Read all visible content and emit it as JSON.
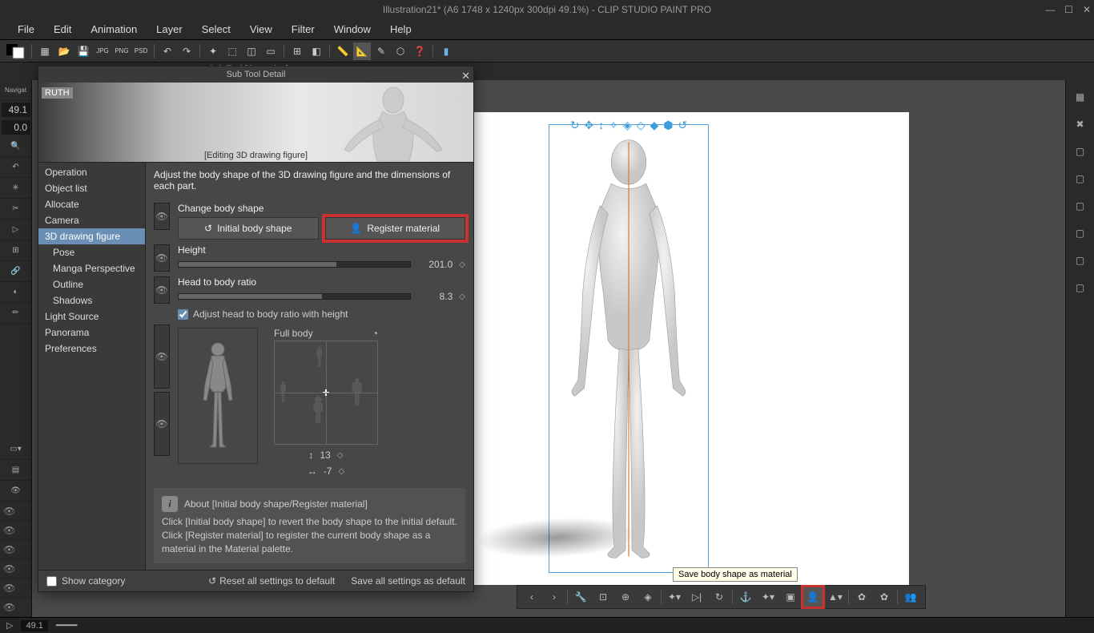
{
  "title": "Illustration21* (A6 1748 x 1240px 300dpi 49.1%)  -  CLIP STUDIO PAINT PRO",
  "menu": [
    "File",
    "Edit",
    "Animation",
    "Layer",
    "Select",
    "View",
    "Filter",
    "Window",
    "Help"
  ],
  "zoom": {
    "v1": "49.1",
    "v2": "0.0"
  },
  "tabstrip": {
    "subtool": "Sub Tool [Operation]"
  },
  "modal": {
    "title": "Sub Tool Detail",
    "hero_tag": "RUTH",
    "hero_caption": "[Editing 3D drawing figure]",
    "nav": [
      "Operation",
      "Object list",
      "Allocate",
      "Camera",
      "3D drawing figure",
      "Pose",
      "Manga Perspective",
      "Outline",
      "Shadows",
      "Light Source",
      "Panorama",
      "Preferences"
    ],
    "nav_selected": 4,
    "desc": "Adjust the body shape of the 3D drawing figure and the dimensions of each part.",
    "change_label": "Change body shape",
    "btn_initial": "Initial body shape",
    "btn_register": "Register material",
    "height_label": "Height",
    "height_val": "201.0",
    "ratio_label": "Head to body ratio",
    "ratio_val": "8.3",
    "adjust_chk": "Adjust head to body ratio with height",
    "fullbody": "Full body",
    "num1": "13",
    "num2": "-7",
    "info_title": "About [Initial body shape/Register material]",
    "info_text": "Click [Initial body shape] to revert the body shape to the initial default. Click [Register material] to register the current body shape as a material in the Material palette.",
    "show_cat": "Show category",
    "reset_default": "Reset all settings to default",
    "save_default": "Save all settings as default"
  },
  "tooltip": "Save body shape as material",
  "status": {
    "zoom": "49.1"
  }
}
